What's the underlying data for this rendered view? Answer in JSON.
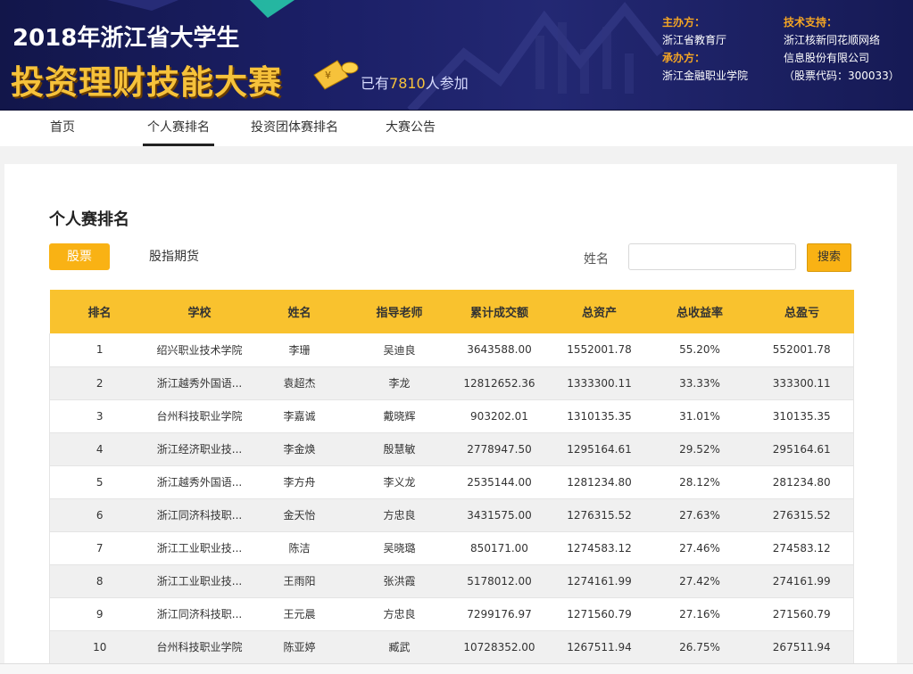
{
  "banner": {
    "year_title": "2018年浙江省大学生",
    "big_title": "投资理财技能大赛",
    "participants_prefix": "已有",
    "participants_count": "7810",
    "participants_suffix": "人参加",
    "host_label": "主办方：",
    "host_value": "浙江省教育厅",
    "organizer_label": "承办方：",
    "organizer_value": "浙江金融职业学院",
    "tech_label": "技术支持：",
    "tech_line1": "浙江核新同花顺网络",
    "tech_line2": "信息股份有限公司",
    "tech_line3": "（股票代码：300033）",
    "accent_color": "#f6c23b"
  },
  "nav": {
    "items": [
      {
        "label": "首页"
      },
      {
        "label": "个人赛排名"
      },
      {
        "label": "投资团体赛排名"
      },
      {
        "label": "大赛公告"
      }
    ],
    "active_index": 1
  },
  "main": {
    "section_title": "个人赛排名",
    "tabs": [
      {
        "label": "股票"
      },
      {
        "label": "股指期货"
      }
    ],
    "search": {
      "label": "姓名",
      "placeholder": "",
      "value": "",
      "button": "搜索"
    }
  },
  "table": {
    "headers": [
      "排名",
      "学校",
      "姓名",
      "指导老师",
      "累计成交额",
      "总资产",
      "总收益率",
      "总盈亏"
    ],
    "rows": [
      [
        "1",
        "绍兴职业技术学院",
        "李珊",
        "吴迪良",
        "3643588.00",
        "1552001.78",
        "55.20%",
        "552001.78"
      ],
      [
        "2",
        "浙江越秀外国语...",
        "袁超杰",
        "李龙",
        "12812652.36",
        "1333300.11",
        "33.33%",
        "333300.11"
      ],
      [
        "3",
        "台州科技职业学院",
        "李嘉诚",
        "戴晓辉",
        "903202.01",
        "1310135.35",
        "31.01%",
        "310135.35"
      ],
      [
        "4",
        "浙江经济职业技...",
        "李金焕",
        "殷慧敏",
        "2778947.50",
        "1295164.61",
        "29.52%",
        "295164.61"
      ],
      [
        "5",
        "浙江越秀外国语...",
        "李方舟",
        "李义龙",
        "2535144.00",
        "1281234.80",
        "28.12%",
        "281234.80"
      ],
      [
        "6",
        "浙江同济科技职...",
        "金天怡",
        "方忠良",
        "3431575.00",
        "1276315.52",
        "27.63%",
        "276315.52"
      ],
      [
        "7",
        "浙江工业职业技...",
        "陈洁",
        "吴晓璐",
        "850171.00",
        "1274583.12",
        "27.46%",
        "274583.12"
      ],
      [
        "8",
        "浙江工业职业技...",
        "王雨阳",
        "张洪霞",
        "5178012.00",
        "1274161.99",
        "27.42%",
        "274161.99"
      ],
      [
        "9",
        "浙江同济科技职...",
        "王元晨",
        "方忠良",
        "7299176.97",
        "1271560.79",
        "27.16%",
        "271560.79"
      ],
      [
        "10",
        "台州科技职业学院",
        "陈亚婷",
        "臧武",
        "10728352.00",
        "1267511.94",
        "26.75%",
        "267511.94"
      ]
    ]
  }
}
